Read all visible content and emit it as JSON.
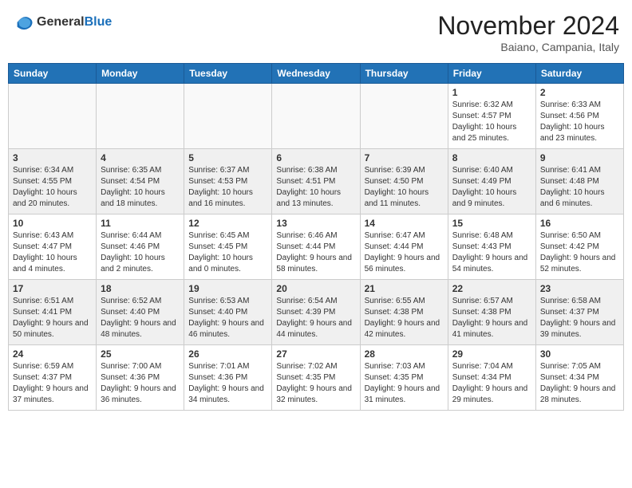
{
  "header": {
    "logo_general": "General",
    "logo_blue": "Blue",
    "month_title": "November 2024",
    "subtitle": "Baiano, Campania, Italy"
  },
  "weekdays": [
    "Sunday",
    "Monday",
    "Tuesday",
    "Wednesday",
    "Thursday",
    "Friday",
    "Saturday"
  ],
  "weeks": [
    {
      "row_shade": false,
      "days": [
        {
          "num": "",
          "info": "",
          "empty": true
        },
        {
          "num": "",
          "info": "",
          "empty": true
        },
        {
          "num": "",
          "info": "",
          "empty": true
        },
        {
          "num": "",
          "info": "",
          "empty": true
        },
        {
          "num": "",
          "info": "",
          "empty": true
        },
        {
          "num": "1",
          "info": "Sunrise: 6:32 AM\nSunset: 4:57 PM\nDaylight: 10 hours and 25 minutes.",
          "empty": false
        },
        {
          "num": "2",
          "info": "Sunrise: 6:33 AM\nSunset: 4:56 PM\nDaylight: 10 hours and 23 minutes.",
          "empty": false
        }
      ]
    },
    {
      "row_shade": true,
      "days": [
        {
          "num": "3",
          "info": "Sunrise: 6:34 AM\nSunset: 4:55 PM\nDaylight: 10 hours and 20 minutes.",
          "empty": false
        },
        {
          "num": "4",
          "info": "Sunrise: 6:35 AM\nSunset: 4:54 PM\nDaylight: 10 hours and 18 minutes.",
          "empty": false
        },
        {
          "num": "5",
          "info": "Sunrise: 6:37 AM\nSunset: 4:53 PM\nDaylight: 10 hours and 16 minutes.",
          "empty": false
        },
        {
          "num": "6",
          "info": "Sunrise: 6:38 AM\nSunset: 4:51 PM\nDaylight: 10 hours and 13 minutes.",
          "empty": false
        },
        {
          "num": "7",
          "info": "Sunrise: 6:39 AM\nSunset: 4:50 PM\nDaylight: 10 hours and 11 minutes.",
          "empty": false
        },
        {
          "num": "8",
          "info": "Sunrise: 6:40 AM\nSunset: 4:49 PM\nDaylight: 10 hours and 9 minutes.",
          "empty": false
        },
        {
          "num": "9",
          "info": "Sunrise: 6:41 AM\nSunset: 4:48 PM\nDaylight: 10 hours and 6 minutes.",
          "empty": false
        }
      ]
    },
    {
      "row_shade": false,
      "days": [
        {
          "num": "10",
          "info": "Sunrise: 6:43 AM\nSunset: 4:47 PM\nDaylight: 10 hours and 4 minutes.",
          "empty": false
        },
        {
          "num": "11",
          "info": "Sunrise: 6:44 AM\nSunset: 4:46 PM\nDaylight: 10 hours and 2 minutes.",
          "empty": false
        },
        {
          "num": "12",
          "info": "Sunrise: 6:45 AM\nSunset: 4:45 PM\nDaylight: 10 hours and 0 minutes.",
          "empty": false
        },
        {
          "num": "13",
          "info": "Sunrise: 6:46 AM\nSunset: 4:44 PM\nDaylight: 9 hours and 58 minutes.",
          "empty": false
        },
        {
          "num": "14",
          "info": "Sunrise: 6:47 AM\nSunset: 4:44 PM\nDaylight: 9 hours and 56 minutes.",
          "empty": false
        },
        {
          "num": "15",
          "info": "Sunrise: 6:48 AM\nSunset: 4:43 PM\nDaylight: 9 hours and 54 minutes.",
          "empty": false
        },
        {
          "num": "16",
          "info": "Sunrise: 6:50 AM\nSunset: 4:42 PM\nDaylight: 9 hours and 52 minutes.",
          "empty": false
        }
      ]
    },
    {
      "row_shade": true,
      "days": [
        {
          "num": "17",
          "info": "Sunrise: 6:51 AM\nSunset: 4:41 PM\nDaylight: 9 hours and 50 minutes.",
          "empty": false
        },
        {
          "num": "18",
          "info": "Sunrise: 6:52 AM\nSunset: 4:40 PM\nDaylight: 9 hours and 48 minutes.",
          "empty": false
        },
        {
          "num": "19",
          "info": "Sunrise: 6:53 AM\nSunset: 4:40 PM\nDaylight: 9 hours and 46 minutes.",
          "empty": false
        },
        {
          "num": "20",
          "info": "Sunrise: 6:54 AM\nSunset: 4:39 PM\nDaylight: 9 hours and 44 minutes.",
          "empty": false
        },
        {
          "num": "21",
          "info": "Sunrise: 6:55 AM\nSunset: 4:38 PM\nDaylight: 9 hours and 42 minutes.",
          "empty": false
        },
        {
          "num": "22",
          "info": "Sunrise: 6:57 AM\nSunset: 4:38 PM\nDaylight: 9 hours and 41 minutes.",
          "empty": false
        },
        {
          "num": "23",
          "info": "Sunrise: 6:58 AM\nSunset: 4:37 PM\nDaylight: 9 hours and 39 minutes.",
          "empty": false
        }
      ]
    },
    {
      "row_shade": false,
      "days": [
        {
          "num": "24",
          "info": "Sunrise: 6:59 AM\nSunset: 4:37 PM\nDaylight: 9 hours and 37 minutes.",
          "empty": false
        },
        {
          "num": "25",
          "info": "Sunrise: 7:00 AM\nSunset: 4:36 PM\nDaylight: 9 hours and 36 minutes.",
          "empty": false
        },
        {
          "num": "26",
          "info": "Sunrise: 7:01 AM\nSunset: 4:36 PM\nDaylight: 9 hours and 34 minutes.",
          "empty": false
        },
        {
          "num": "27",
          "info": "Sunrise: 7:02 AM\nSunset: 4:35 PM\nDaylight: 9 hours and 32 minutes.",
          "empty": false
        },
        {
          "num": "28",
          "info": "Sunrise: 7:03 AM\nSunset: 4:35 PM\nDaylight: 9 hours and 31 minutes.",
          "empty": false
        },
        {
          "num": "29",
          "info": "Sunrise: 7:04 AM\nSunset: 4:34 PM\nDaylight: 9 hours and 29 minutes.",
          "empty": false
        },
        {
          "num": "30",
          "info": "Sunrise: 7:05 AM\nSunset: 4:34 PM\nDaylight: 9 hours and 28 minutes.",
          "empty": false
        }
      ]
    }
  ]
}
